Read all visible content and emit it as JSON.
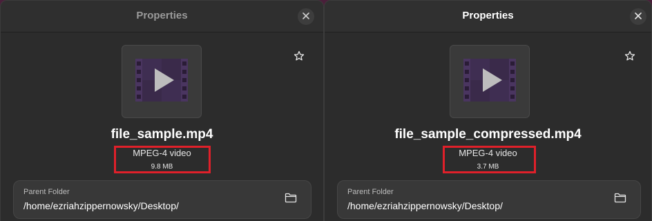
{
  "dialogs": [
    {
      "title": "Properties",
      "filename": "file_sample.mp4",
      "filetype": "MPEG-4 video",
      "filesize": "9.8 MB",
      "parent_label": "Parent Folder",
      "parent_path": "/home/ezriahzippernowsky/Desktop/",
      "icons": {
        "close": "close-icon",
        "star": "star-icon",
        "folder": "folder-icon",
        "thumbnail": "video-file-icon"
      }
    },
    {
      "title": "Properties",
      "filename": "file_sample_compressed.mp4",
      "filetype": "MPEG-4 video",
      "filesize": "3.7 MB",
      "parent_label": "Parent Folder",
      "parent_path": "/home/ezriahzippernowsky/Desktop/",
      "icons": {
        "close": "close-icon",
        "star": "star-icon",
        "folder": "folder-icon",
        "thumbnail": "video-file-icon"
      }
    }
  ],
  "colors": {
    "desktop_bg": "#4a1f3a",
    "dialog_bg": "#2c2c2c",
    "highlight": "#e0202a",
    "film_dark": "#3a2a4a",
    "play_fill": "#bdbdbd"
  }
}
